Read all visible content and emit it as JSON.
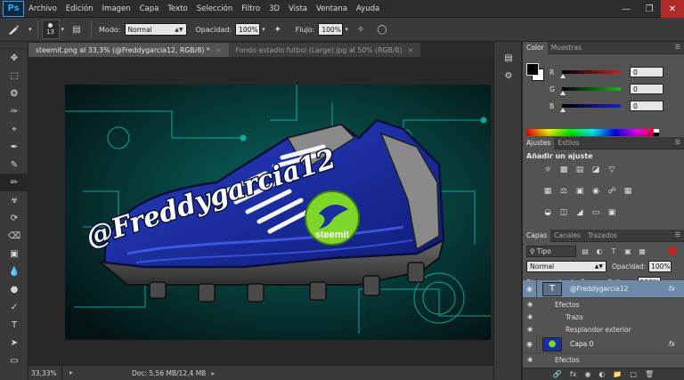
{
  "app": {
    "logo": "Ps",
    "menu": [
      "Archivo",
      "Edición",
      "Imagen",
      "Capa",
      "Texto",
      "Selección",
      "Filtro",
      "3D",
      "Vista",
      "Ventana",
      "Ayuda"
    ],
    "window_controls": [
      "minimize-icon",
      "restore-icon",
      "close-icon"
    ]
  },
  "options_bar": {
    "brush_size": "13",
    "mode_label": "Modo:",
    "mode_value": "Normal",
    "opacity_label": "Opacidad:",
    "opacity_value": "100%",
    "flow_label": "Flujo:",
    "flow_value": "100%"
  },
  "tabs": [
    {
      "label": "steemit.png al 33,3% (@Freddygarcia12, RGB/8) *",
      "active": true
    },
    {
      "label": "Fondo estadio futbol (Large).jpg al 50% (RGB/8)",
      "active": false
    }
  ],
  "canvas": {
    "watermark_text": "@Freddygarcia12",
    "logo_text": "steemit",
    "colors": {
      "background": "#0d2d2a",
      "glow": "#18d6c8",
      "shoe": "#1a2fa0",
      "sole": "#4a4a4a",
      "steemit_green": "#7fd62a"
    }
  },
  "status": {
    "zoom": "33,33%",
    "doc": "Doc: 5,56 MB/12,4 MB"
  },
  "color_panel": {
    "tabs": [
      "Color",
      "Muestras"
    ],
    "channels": [
      {
        "label": "R",
        "value": "0",
        "color": "#d21e1e"
      },
      {
        "label": "G",
        "value": "0",
        "color": "#1eb41e"
      },
      {
        "label": "B",
        "value": "0",
        "color": "#1e1ed2"
      }
    ]
  },
  "adjust_panel": {
    "tabs": [
      "Ajustes",
      "Estilos"
    ],
    "title": "Añadir un ajuste"
  },
  "layers_panel": {
    "tabs": [
      "Capas",
      "Canales",
      "Trazados"
    ],
    "filter": "Tipo",
    "blend_mode": "Normal",
    "opacity_label": "Opacidad:",
    "opacity_value": "100%",
    "lock_label": "Bloq.:",
    "fill_label": "Relleno:",
    "fill_value": "100%",
    "layers": [
      {
        "name": "@Freddygarcia12",
        "fx": "fx",
        "effects_label": "Efectos",
        "effects": [
          "Trazo",
          "Resplandor exterior"
        ]
      },
      {
        "name": "Capa 0",
        "fx": "fx",
        "effects_label": "Efectos"
      }
    ]
  }
}
